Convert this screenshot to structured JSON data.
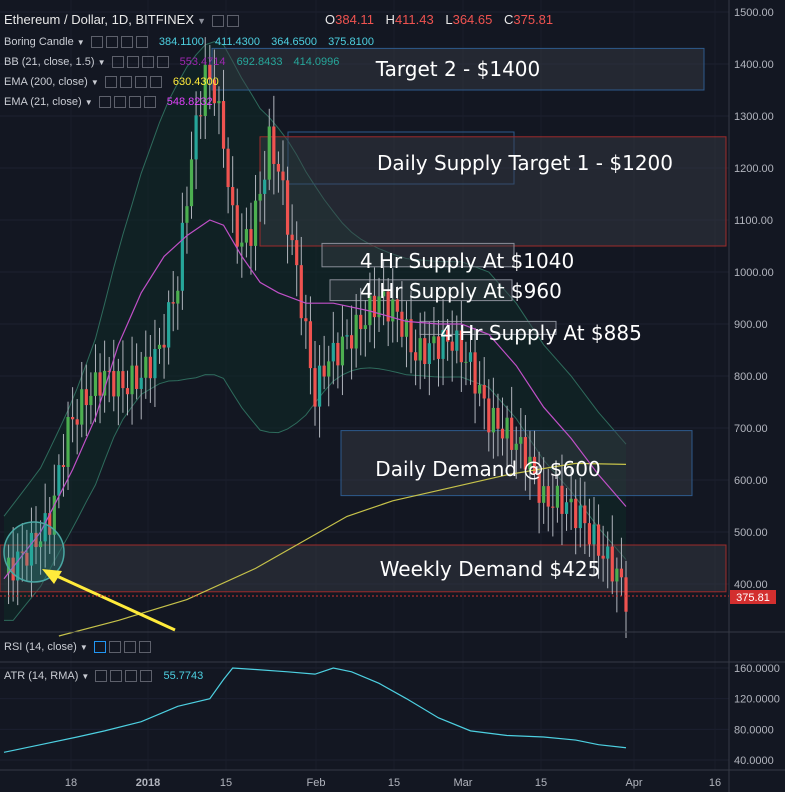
{
  "header": {
    "title": "Ethereum / Dollar, 1D, BITFINEX",
    "ohlc": {
      "o_label": "O",
      "o": "384.11",
      "h_label": "H",
      "h": "411.43",
      "l_label": "L",
      "l": "364.65",
      "c_label": "C",
      "c": "375.81"
    }
  },
  "indicators": [
    {
      "name": "Boring Candle",
      "values": [
        "384.1100",
        "411.4300",
        "364.6500",
        "375.8100"
      ],
      "color": "#4dd0e1"
    },
    {
      "name": "BB (21, close, 1.5)",
      "values": [
        "553.4714",
        "692.8433",
        "414.0996"
      ],
      "color": "#9c27b0"
    },
    {
      "name": "EMA (200, close)",
      "values": [
        "630.4300"
      ],
      "color": "#ffeb3b"
    },
    {
      "name": "EMA (21, close)",
      "values": [
        "548.8232"
      ],
      "color": "#e040fb"
    }
  ],
  "rsi_label": "RSI (14, close)",
  "atr": {
    "label": "ATR (14, RMA)",
    "value": "55.7743"
  },
  "colors": {
    "bg": "#131722",
    "up": "#26a69a",
    "up_bright": "#4caf50",
    "down": "#ef5350",
    "price_tag": "#d32f2f",
    "arrow": "#ffeb3b",
    "bb": "#1e4a3e",
    "ema200": "#c6c24a",
    "ema21": "#c050c8"
  },
  "chart_data": {
    "type": "line",
    "title": "Ethereum / Dollar, 1D, BITFINEX",
    "price_axis": {
      "ticks": [
        "1500.00",
        "1400.00",
        "1300.00",
        "1200.00",
        "1100.00",
        "1000.00",
        "900.00",
        "800.00",
        "700.00",
        "600.00",
        "500.00",
        "400.00"
      ],
      "ylim": [
        300,
        1500
      ],
      "last_price_tag": "375.81"
    },
    "atr_axis": {
      "ticks": [
        "160.0000",
        "120.0000",
        "80.0000",
        "40.0000"
      ],
      "ylim": [
        30,
        170
      ]
    },
    "x_ticks": [
      "18",
      "2018",
      "15",
      "Feb",
      "15",
      "Mar",
      "15",
      "Apr",
      "16"
    ],
    "zones": [
      {
        "label": "Target 2 - $1400",
        "from": 1350,
        "to": 1430
      },
      {
        "label": "Daily Supply Target 1 - $1200",
        "from": 1050,
        "to": 1260
      },
      {
        "label": "4 Hr Supply At $1040",
        "from": 1010,
        "to": 1055
      },
      {
        "label": "4 Hr Supply At $960",
        "from": 945,
        "to": 985
      },
      {
        "label": "4 Hr Supply At $885",
        "from": 880,
        "to": 905
      },
      {
        "label": "Daily Demand @ $600",
        "from": 570,
        "to": 695
      },
      {
        "label": "Weekly Demand $425",
        "from": 385,
        "to": 475
      }
    ],
    "series": [
      {
        "name": "EMA (200, close)",
        "points": [
          [
            12,
            300
          ],
          [
            25,
            330
          ],
          [
            40,
            370
          ],
          [
            55,
            430
          ],
          [
            65,
            480
          ],
          [
            75,
            530
          ],
          [
            85,
            560
          ],
          [
            95,
            580
          ],
          [
            110,
            610
          ],
          [
            120,
            625
          ],
          [
            125,
            632
          ],
          [
            136,
            630
          ]
        ]
      },
      {
        "name": "EMA (21, close)",
        "points": [
          [
            0,
            410
          ],
          [
            8,
            500
          ],
          [
            15,
            620
          ],
          [
            20,
            720
          ],
          [
            25,
            860
          ],
          [
            30,
            960
          ],
          [
            35,
            1030
          ],
          [
            40,
            1070
          ],
          [
            45,
            1100
          ],
          [
            48,
            1090
          ],
          [
            52,
            1030
          ],
          [
            56,
            980
          ],
          [
            60,
            960
          ],
          [
            66,
            940
          ],
          [
            72,
            940
          ],
          [
            80,
            925
          ],
          [
            88,
            905
          ],
          [
            95,
            900
          ],
          [
            100,
            900
          ],
          [
            106,
            880
          ],
          [
            112,
            820
          ],
          [
            118,
            740
          ],
          [
            124,
            680
          ],
          [
            130,
            610
          ],
          [
            136,
            549
          ]
        ]
      },
      {
        "name": "ATR (14, RMA)",
        "points": [
          [
            0,
            50
          ],
          [
            8,
            60
          ],
          [
            16,
            70
          ],
          [
            22,
            78
          ],
          [
            30,
            90
          ],
          [
            38,
            110
          ],
          [
            45,
            120
          ],
          [
            48,
            145
          ],
          [
            50,
            160
          ],
          [
            55,
            158
          ],
          [
            62,
            155
          ],
          [
            68,
            152
          ],
          [
            72,
            160
          ],
          [
            76,
            155
          ],
          [
            82,
            140
          ],
          [
            88,
            120
          ],
          [
            95,
            95
          ],
          [
            102,
            78
          ],
          [
            110,
            72
          ],
          [
            118,
            70
          ],
          [
            125,
            66
          ],
          [
            130,
            60
          ],
          [
            136,
            56
          ]
        ]
      }
    ]
  }
}
